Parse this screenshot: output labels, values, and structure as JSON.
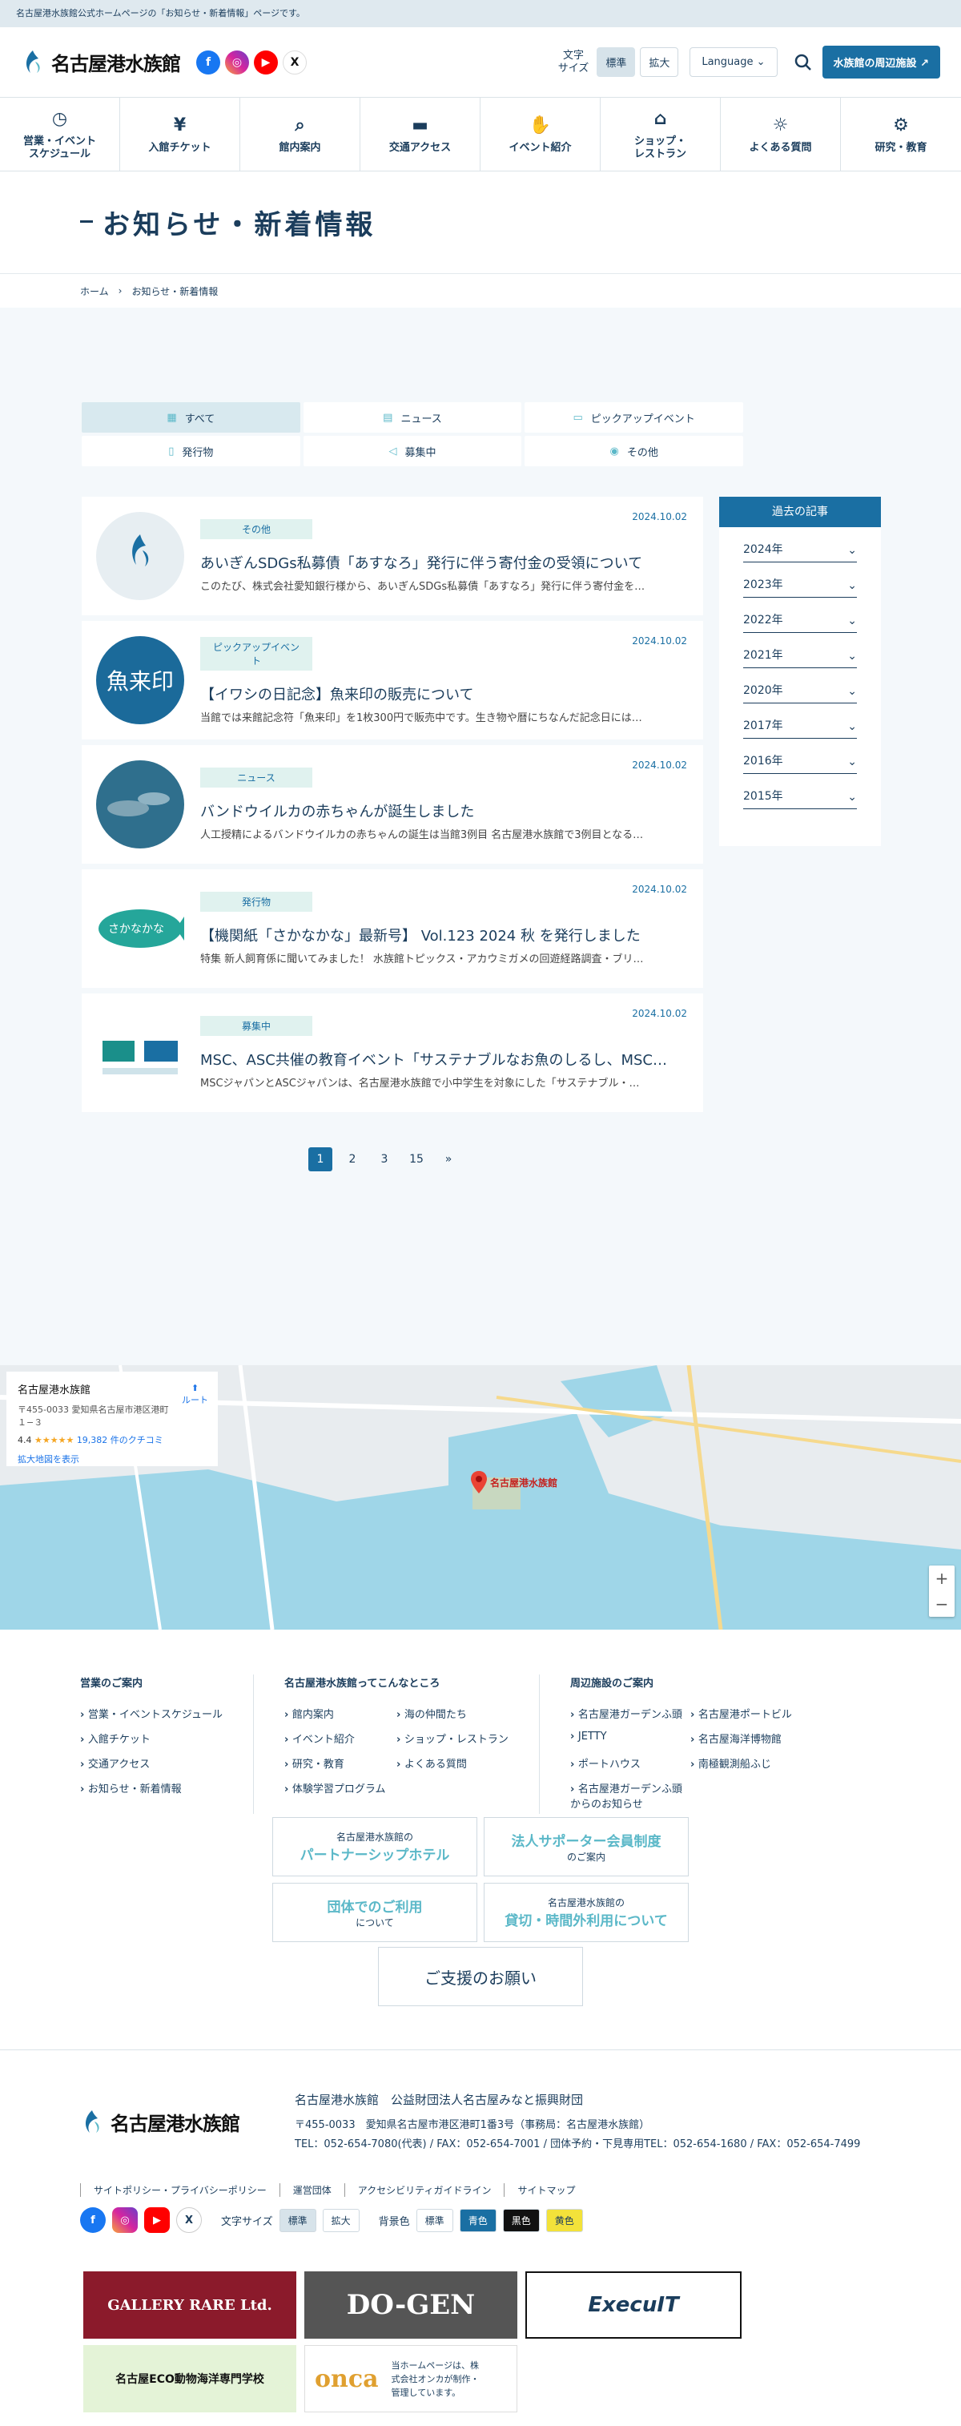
{
  "topbar": "名古屋港水族館公式ホームページの「お知らせ・新着情報」ページです。",
  "site": {
    "name": "名古屋港水族館"
  },
  "header": {
    "fontsize_label": "文字\nサイズ",
    "font_standard": "標準",
    "font_large": "拡大",
    "language": "Language",
    "surround": "水族館の周辺施設"
  },
  "gnav": [
    {
      "label": "営業・イベント\nスケジュール",
      "icon": "clock-icon"
    },
    {
      "label": "入館チケット",
      "icon": "yen-icon"
    },
    {
      "label": "館内案内",
      "icon": "map-search-icon"
    },
    {
      "label": "交通アクセス",
      "icon": "bus-icon"
    },
    {
      "label": "イベント紹介",
      "icon": "hand-icon"
    },
    {
      "label": "ショップ・\nレストラン",
      "icon": "shop-icon"
    },
    {
      "label": "よくある質問",
      "icon": "bulb-icon"
    },
    {
      "label": "研究・教育",
      "icon": "gear-icon"
    }
  ],
  "page": {
    "title": "お知らせ・新着情報"
  },
  "breadcrumb": [
    "ホーム",
    "お知らせ・新着情報"
  ],
  "tabs": [
    {
      "label": "すべて",
      "icon": "grid-icon"
    },
    {
      "label": "ニュース",
      "icon": "document-icon"
    },
    {
      "label": "ピックアップイベント",
      "icon": "calendar-icon"
    },
    {
      "label": "発行物",
      "icon": "book-icon"
    },
    {
      "label": "募集中",
      "icon": "megaphone-icon"
    },
    {
      "label": "その他",
      "icon": "aquarium-icon"
    }
  ],
  "news": [
    {
      "date": "2024.10.02",
      "cat": "その他",
      "title": "あいぎんSDGs私募債「あすなろ」発行に伴う寄付金の受領について",
      "desc": "このたび、株式会社愛知銀行様から、あいぎんSDGs私募債「あすなろ」発行に伴う寄付金を…"
    },
    {
      "date": "2024.10.02",
      "cat": "ピックアップイベント",
      "title": "【イワシの日記念】魚来印の販売について",
      "desc": "当館では来館記念符「魚来印」を1枚300円で販売中です。生き物や暦にちなんだ記念日には…"
    },
    {
      "date": "2024.10.02",
      "cat": "ニュース",
      "title": "バンドウイルカの赤ちゃんが誕生しました",
      "desc": "人工授精によるバンドウイルカの赤ちゃんの誕生は当館3例目 名古屋港水族館で3例目となる…"
    },
    {
      "date": "2024.10.02",
      "cat": "発行物",
      "title": "【機関紙「さかなかな」最新号】 Vol.123 2024 秋 を発行しました",
      "desc": "特集 新人飼育係に聞いてみました！ 水族館トピックス・アカウミガメの回遊経路調査・ブリ…"
    },
    {
      "date": "2024.10.02",
      "cat": "募集中",
      "title": "MSC、ASC共催の教育イベント「サステナブルなお魚のしるし、MSC…",
      "desc": "MSCジャパンとASCジャパンは、名古屋港水族館で小中学生を対象にした「サステナブル・…"
    }
  ],
  "thumb_texts": {
    "t2": "魚来印",
    "t4": "さかなかな"
  },
  "archive": {
    "title": "過去の記事",
    "years": [
      "2024年",
      "2023年",
      "2022年",
      "2021年",
      "2020年",
      "2017年",
      "2016年",
      "2015年"
    ]
  },
  "pager": [
    "1",
    "2",
    "3",
    "15",
    "»"
  ],
  "map": {
    "name": "名古屋港水族館",
    "addr": "〒455-0033 愛知県名古屋市港区港町\n１−３",
    "rating": "4.4",
    "stars": "★★★★★",
    "reviews": "19,382 件のクチコミ",
    "enlarge": "拡大地図を表示",
    "route": "ルート",
    "pin": "名古屋港水族館"
  },
  "footer_nav": [
    {
      "title": "営業のご案内",
      "items": [
        "営業・イベントスケジュール",
        "入館チケット",
        "交通アクセス",
        "お知らせ・新着情報"
      ]
    },
    {
      "title": "名古屋港水族館ってこんなところ",
      "items": [
        "館内案内",
        "海の仲間たち",
        "イベント紹介",
        "ショップ・レストラン",
        "研究・教育",
        "よくある質問",
        "体験学習プログラム"
      ]
    },
    {
      "title": "周辺施設のご案内",
      "items": [
        "名古屋港ガーデンふ頭",
        "名古屋港ポートビル",
        "JETTY",
        "名古屋海洋博物館",
        "ポートハウス",
        "南極観測船ふじ",
        "名古屋港ガーデンふ頭からのお知らせ"
      ]
    }
  ],
  "banners": [
    {
      "sub": "名古屋港水族館の",
      "main": "パートナーシップホテル"
    },
    {
      "sub": "のご案内",
      "main": "法人サポーター会員制度"
    },
    {
      "sub": "について",
      "main": "団体でのご利用"
    },
    {
      "sub": "名古屋港水族館の",
      "main": "貸切・時間外利用について"
    }
  ],
  "support": "ご支援のお願い",
  "footer": {
    "org": "名古屋港水族館　公益財団法人名古屋みなと振興財団",
    "addr": "〒455-0033　愛知県名古屋市港区港町1番3号（事務局：名古屋港水族館）",
    "tel": "TEL：052-654-7080(代表) / FAX：052-654-7001 / 団体予約・下見専用TEL：052-654-1680 / FAX：052-654-7499",
    "links": [
      "サイトポリシー・プライバシーポリシー",
      "運営団体",
      "アクセシビリティガイドライン",
      "サイトマップ"
    ],
    "fontsize": "文字サイズ",
    "font_standard": "標準",
    "font_large": "拡大",
    "bg": "背景色",
    "bg_std": "標準",
    "bg_blue": "青色",
    "bg_black": "黒色",
    "bg_yellow": "黄色"
  },
  "ads": [
    {
      "label": "GALLERY RARE Ltd."
    },
    {
      "label": "DO-GEN"
    },
    {
      "label": "ExecuIT"
    },
    {
      "label": "名古屋ECO動物海洋専門学校"
    },
    {
      "label": "onca"
    },
    {
      "label": "当ホームページは、株式会社オンカが制作・管理しています。"
    }
  ],
  "colors": {
    "brand": "#1a6fa3",
    "navy": "#1b3d5c",
    "mint": "#e0f2ef"
  }
}
